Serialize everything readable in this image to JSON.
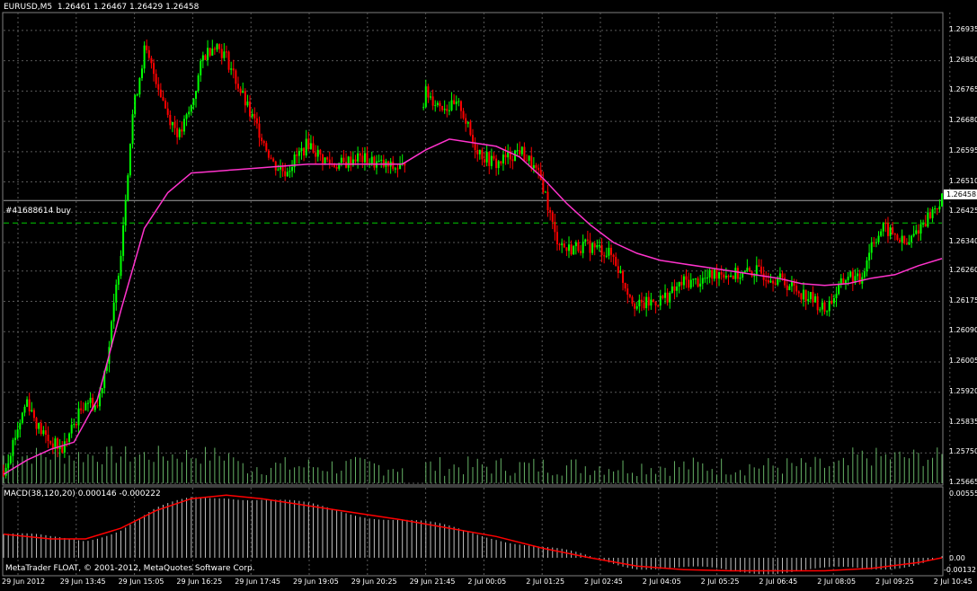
{
  "header": {
    "symbol_info": "EURUSD,M5",
    "ohlc": "1.26461 1.26467 1.26429 1.26458"
  },
  "order_label": "#41688614 buy",
  "current_price": "1.26458",
  "macd": {
    "label": "MACD(38,120,20)",
    "values": "0.000146 -0.000222",
    "scale": [
      "0.00555",
      "0.00",
      "-0.00132"
    ]
  },
  "copyright": "MetaTrader FLOAT, © 2001-2012, MetaQuotes Software Corp.",
  "colors": {
    "background": "#000000",
    "grid": "#5a5a5a",
    "bull": "#00ff00",
    "bear": "#ff0000",
    "ma": "#ff33cc",
    "volume": "#66b266",
    "order_line": "#00cc00",
    "macd_hist": "#c0c0c0",
    "macd_signal": "#ff0000"
  },
  "chart_data": {
    "type": "candlestick",
    "symbol": "EURUSD",
    "timeframe": "M5",
    "price_ticks": [
      "1.26935",
      "1.26850",
      "1.26765",
      "1.26680",
      "1.26595",
      "1.26510",
      "1.26425",
      "1.26340",
      "1.26260",
      "1.26175",
      "1.26090",
      "1.26005",
      "1.25920",
      "1.25835",
      "1.25750",
      "1.25665"
    ],
    "time_ticks": [
      "29 Jun 2012",
      "29 Jun 13:45",
      "29 Jun 15:05",
      "29 Jun 16:25",
      "29 Jun 17:45",
      "29 Jun 19:05",
      "29 Jun 20:25",
      "29 Jun 21:45",
      "2 Jul 00:05",
      "2 Jul 01:25",
      "2 Jul 02:45",
      "2 Jul 04:05",
      "2 Jul 05:25",
      "2 Jul 06:45",
      "2 Jul 08:05",
      "2 Jul 09:25",
      "2 Jul 10:45"
    ],
    "ylim": [
      1.25665,
      1.26985
    ],
    "order_price": 1.26395,
    "last_price": 1.26458,
    "price_path": [
      [
        0,
        1.257
      ],
      [
        5,
        1.258
      ],
      [
        10,
        1.259
      ],
      [
        15,
        1.2582
      ],
      [
        20,
        1.2578
      ],
      [
        25,
        1.2576
      ],
      [
        30,
        1.2583
      ],
      [
        35,
        1.259
      ],
      [
        40,
        1.2588
      ],
      [
        45,
        1.2605
      ],
      [
        50,
        1.2632
      ],
      [
        55,
        1.267
      ],
      [
        60,
        1.2688
      ],
      [
        65,
        1.268
      ],
      [
        70,
        1.267
      ],
      [
        75,
        1.2664
      ],
      [
        80,
        1.2672
      ],
      [
        85,
        1.2686
      ],
      [
        90,
        1.269
      ],
      [
        95,
        1.2686
      ],
      [
        100,
        1.2678
      ],
      [
        105,
        1.267
      ],
      [
        110,
        1.2664
      ],
      [
        115,
        1.2656
      ],
      [
        120,
        1.2654
      ],
      [
        125,
        1.2658
      ],
      [
        130,
        1.2662
      ],
      [
        135,
        1.2658
      ],
      [
        140,
        1.2656
      ],
      [
        145,
        1.2656
      ],
      [
        150,
        1.2658
      ],
      [
        155,
        1.2657
      ],
      [
        160,
        1.2656
      ],
      [
        165,
        1.2655
      ],
      [
        170,
        1.2655
      ],
      [
        180,
        1.2676
      ],
      [
        185,
        1.2673
      ],
      [
        190,
        1.2672
      ],
      [
        195,
        1.2672
      ],
      [
        200,
        1.2662
      ],
      [
        205,
        1.2658
      ],
      [
        210,
        1.2656
      ],
      [
        215,
        1.2658
      ],
      [
        220,
        1.266
      ],
      [
        225,
        1.2656
      ],
      [
        230,
        1.265
      ],
      [
        235,
        1.2636
      ],
      [
        240,
        1.2632
      ],
      [
        245,
        1.2633
      ],
      [
        250,
        1.2633
      ],
      [
        255,
        1.2632
      ],
      [
        260,
        1.263
      ],
      [
        265,
        1.2622
      ],
      [
        270,
        1.2616
      ],
      [
        275,
        1.2617
      ],
      [
        280,
        1.2618
      ],
      [
        285,
        1.262
      ],
      [
        290,
        1.2623
      ],
      [
        295,
        1.2623
      ],
      [
        300,
        1.2624
      ],
      [
        305,
        1.2626
      ],
      [
        310,
        1.2625
      ],
      [
        315,
        1.2625
      ],
      [
        320,
        1.2626
      ],
      [
        325,
        1.2625
      ],
      [
        330,
        1.2624
      ],
      [
        335,
        1.2622
      ],
      [
        340,
        1.262
      ],
      [
        345,
        1.2618
      ],
      [
        350,
        1.2615
      ],
      [
        355,
        1.262
      ],
      [
        360,
        1.2625
      ],
      [
        365,
        1.2623
      ],
      [
        370,
        1.2634
      ],
      [
        375,
        1.2638
      ],
      [
        380,
        1.2636
      ],
      [
        385,
        1.2633
      ],
      [
        390,
        1.2638
      ],
      [
        395,
        1.2642
      ],
      [
        400,
        1.2646
      ]
    ],
    "ma_path": [
      [
        0,
        1.2569
      ],
      [
        10,
        1.2573
      ],
      [
        20,
        1.2576
      ],
      [
        30,
        1.2578
      ],
      [
        40,
        1.259
      ],
      [
        50,
        1.2615
      ],
      [
        60,
        1.2638
      ],
      [
        70,
        1.2648
      ],
      [
        80,
        1.26535
      ],
      [
        90,
        1.2654
      ],
      [
        100,
        1.26545
      ],
      [
        110,
        1.2655
      ],
      [
        120,
        1.26555
      ],
      [
        130,
        1.2656
      ],
      [
        140,
        1.2656
      ],
      [
        150,
        1.2656
      ],
      [
        160,
        1.2656
      ],
      [
        170,
        1.2656
      ],
      [
        180,
        1.266
      ],
      [
        190,
        1.2663
      ],
      [
        200,
        1.2662
      ],
      [
        210,
        1.2661
      ],
      [
        220,
        1.2658
      ],
      [
        230,
        1.2652
      ],
      [
        240,
        1.2645
      ],
      [
        250,
        1.2639
      ],
      [
        260,
        1.2634
      ],
      [
        270,
        1.2631
      ],
      [
        280,
        1.2629
      ],
      [
        290,
        1.2628
      ],
      [
        300,
        1.2627
      ],
      [
        310,
        1.2626
      ],
      [
        320,
        1.2625
      ],
      [
        330,
        1.2624
      ],
      [
        340,
        1.26225
      ],
      [
        350,
        1.2622
      ],
      [
        360,
        1.26225
      ],
      [
        370,
        1.2624
      ],
      [
        380,
        1.2625
      ],
      [
        390,
        1.26275
      ],
      [
        400,
        1.26295
      ]
    ],
    "macd_signal_path": [
      [
        0,
        0.002
      ],
      [
        20,
        0.0016
      ],
      [
        35,
        0.0016
      ],
      [
        50,
        0.0025
      ],
      [
        65,
        0.004
      ],
      [
        80,
        0.005
      ],
      [
        95,
        0.0053
      ],
      [
        110,
        0.005
      ],
      [
        130,
        0.0044
      ],
      [
        150,
        0.0038
      ],
      [
        170,
        0.0032
      ],
      [
        190,
        0.0025
      ],
      [
        210,
        0.0018
      ],
      [
        230,
        0.0008
      ],
      [
        250,
        0.0
      ],
      [
        270,
        -0.0007
      ],
      [
        290,
        -0.001
      ],
      [
        310,
        -0.0011
      ],
      [
        330,
        -0.0011
      ],
      [
        350,
        -0.0011
      ],
      [
        370,
        -0.0009
      ],
      [
        390,
        -0.0004
      ],
      [
        400,
        0.0
      ]
    ]
  }
}
